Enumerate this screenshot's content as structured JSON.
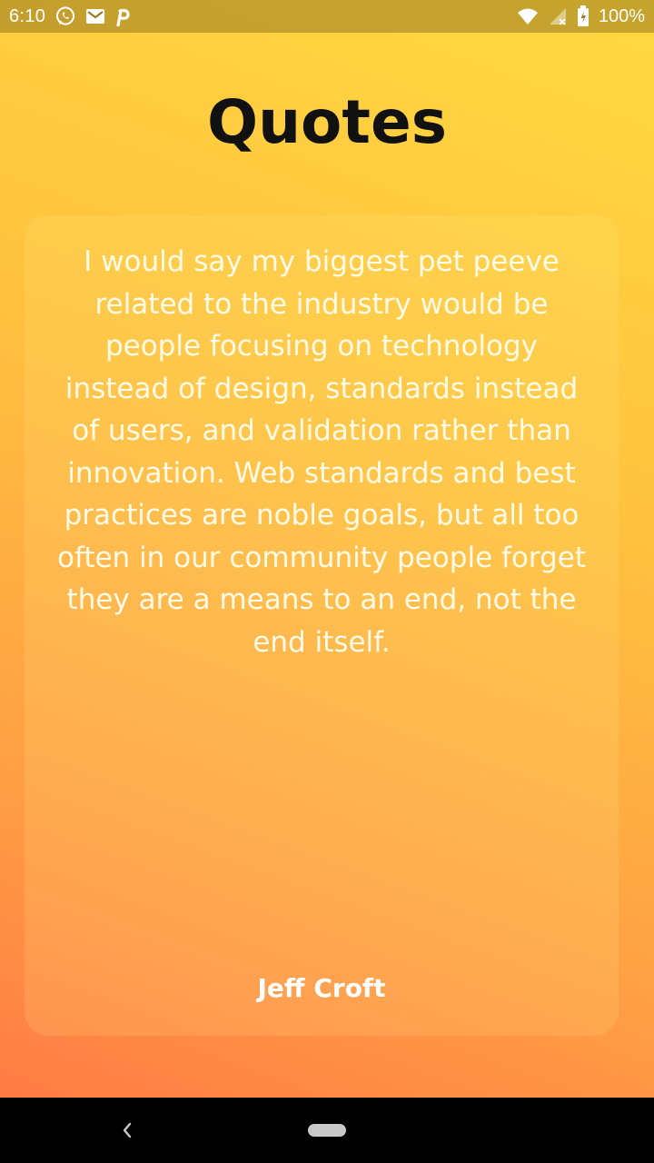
{
  "status_bar": {
    "time": "6:10",
    "battery": "100%",
    "icons": [
      "whatsapp-icon",
      "gmail-icon",
      "pinterest-icon",
      "wifi-icon",
      "signal-icon",
      "battery-icon"
    ]
  },
  "page": {
    "title": "Quotes"
  },
  "quote": {
    "text": "I would say my biggest pet peeve related to the industry would be people focusing on technology instead of design, standards instead of users, and validation rather than innovation. Web standards and best practices are noble goals, but all too often in our community people forget they are a means to an end, not the end itself.",
    "author": "Jeff Croft"
  },
  "nav_bar": {
    "icons": [
      "back-icon",
      "home-pill"
    ]
  },
  "colors": {
    "gradient_top": "#ffd941",
    "gradient_mid": "#ffc23f",
    "gradient_bottom": "#ff7545",
    "title": "#111111",
    "quote_text": "#fffbe8"
  }
}
